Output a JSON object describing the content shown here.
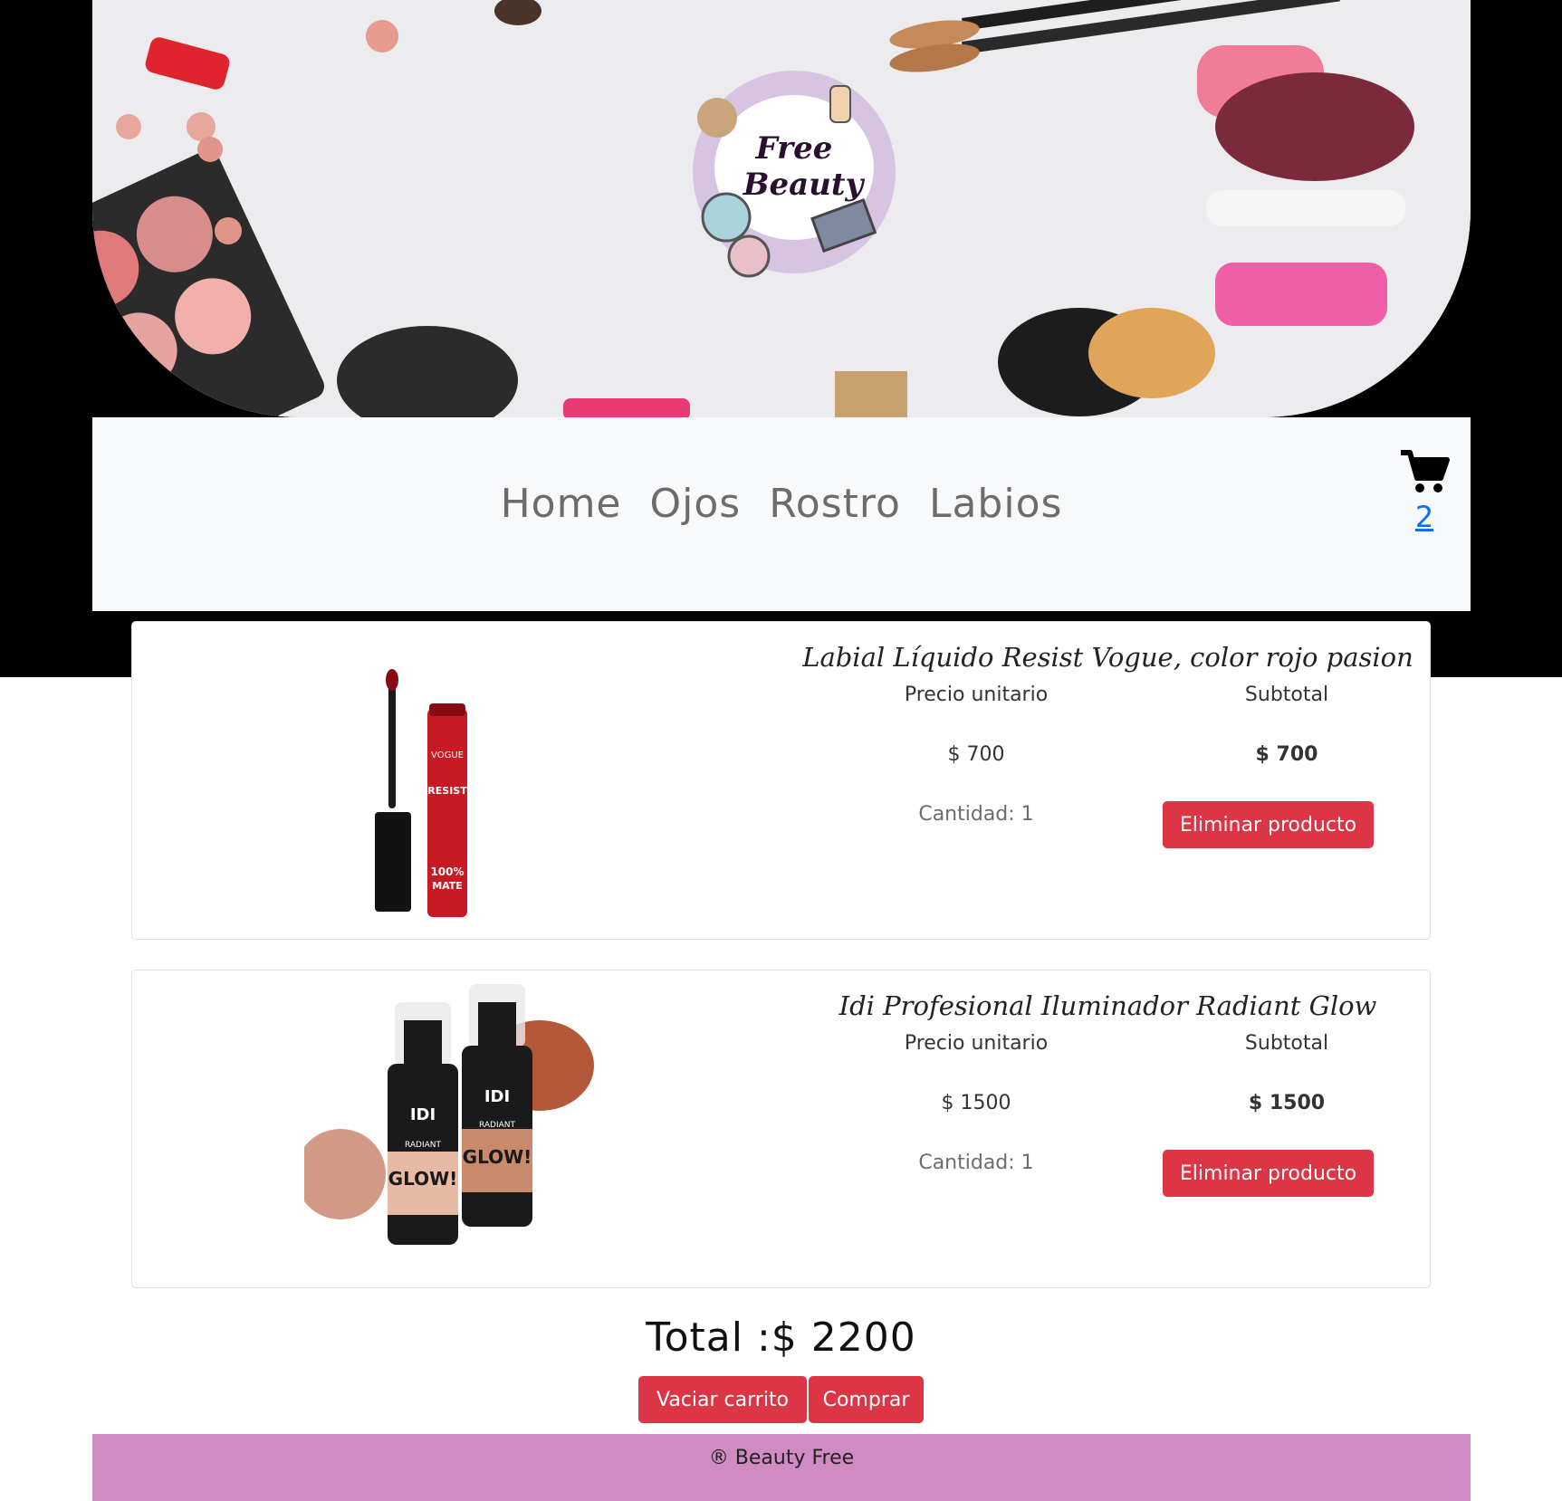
{
  "brand": {
    "logo_text_line1": "Free",
    "logo_text_line2": "Beauty"
  },
  "nav": {
    "items": [
      {
        "label": "Home"
      },
      {
        "label": "Ojos"
      },
      {
        "label": "Rostro"
      },
      {
        "label": "Labios"
      }
    ]
  },
  "cart": {
    "icon": "cart-icon",
    "count": "2"
  },
  "columns": {
    "unit_price_label": "Precio unitario",
    "subtotal_label": "Subtotal"
  },
  "products": [
    {
      "name": "Labial Líquido Resist Vogue, color rojo pasion",
      "unit_price": "$ 700",
      "subtotal": "$ 700",
      "quantity": "Cantidad: 1",
      "remove_label": "Eliminar producto",
      "image_text": [
        "VOGUE",
        "RESIST",
        "100%",
        "MATE"
      ]
    },
    {
      "name": "Idi Profesional Iluminador Radiant Glow",
      "unit_price": "$ 1500",
      "subtotal": "$ 1500",
      "quantity": "Cantidad: 1",
      "remove_label": "Eliminar producto",
      "image_text": [
        "IDI",
        "RADIANT",
        "GLOW!"
      ]
    }
  ],
  "summary": {
    "total": "Total :$ 2200",
    "empty_cart_label": "Vaciar carrito",
    "buy_label": "Comprar"
  },
  "footer": {
    "text": "® Beauty Free"
  },
  "colors": {
    "accent_red": "#dc3545",
    "footer_bg": "#cf8bc2",
    "link_blue": "#0d6efd",
    "nav_bg": "#f8f9fa"
  }
}
